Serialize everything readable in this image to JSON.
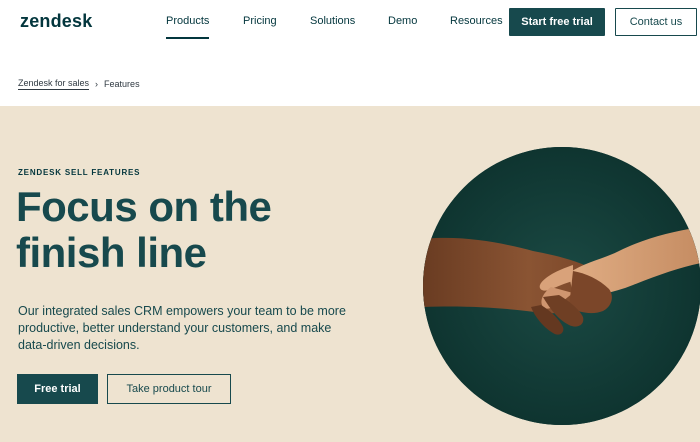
{
  "header": {
    "logo": "zendesk",
    "nav": [
      "Products",
      "Pricing",
      "Solutions",
      "Demo",
      "Resources"
    ],
    "active_nav": "Products",
    "start_trial": "Start free trial",
    "contact": "Contact us"
  },
  "breadcrumb": {
    "parent": "Zendesk for sales",
    "separator": "›",
    "current": "Features"
  },
  "hero": {
    "eyebrow": "ZENDESK SELL FEATURES",
    "headline_line1": "Focus on the",
    "headline_line2": "finish line",
    "subtext": "Our integrated sales CRM empowers your team to be more productive, better understand your customers, and make data-driven decisions.",
    "primary_cta": "Free trial",
    "secondary_cta": "Take product tour",
    "image_icon": "handshake-image"
  },
  "colors": {
    "brand_dark": "#17494d",
    "hero_bg": "#eee3d0",
    "circle_bg": "#0f3a35"
  }
}
